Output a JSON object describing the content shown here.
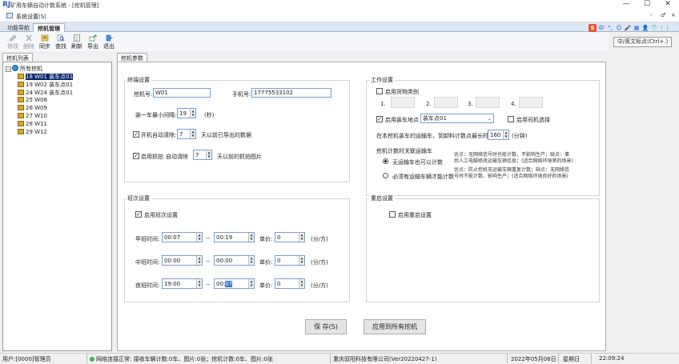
{
  "app": {
    "title": "矿用车辆自动计数系统 - [挖机管理]",
    "logo": "RJ",
    "menu_item": "系统设置(S)",
    "minimize": "—",
    "maximize": "☐",
    "close": "✕",
    "mdi_controls": [
      "-",
      "♂",
      "×"
    ]
  },
  "tabs": [
    {
      "label": "功能导航"
    },
    {
      "label": "挖机管理"
    }
  ],
  "toolbar": {
    "buttons": [
      {
        "label": "修改",
        "icon": "edit-icon",
        "disabled": true
      },
      {
        "label": "删除",
        "icon": "delete-icon",
        "disabled": true
      },
      {
        "label": "同步",
        "icon": "sync-icon",
        "disabled": false
      },
      {
        "label": "查找",
        "icon": "search-icon",
        "disabled": false
      },
      {
        "label": "刷新",
        "icon": "refresh-icon",
        "disabled": false
      },
      {
        "label": "导出",
        "icon": "export-icon",
        "disabled": false
      },
      {
        "label": "退出",
        "icon": "exit-icon",
        "disabled": false
      }
    ]
  },
  "ime": {
    "items": [
      "S",
      "中",
      "°,",
      "☺",
      "🎤",
      "▦",
      "👤",
      "👕",
      "⋮⋮"
    ]
  },
  "lang_button": "中/英文标点(Ctrl+.)",
  "left_panel": {
    "header": "挖机列表",
    "root": "所有挖机",
    "items": [
      "18 W01 装车点01",
      "19 W02 装车点01",
      "24 W24 装车点01",
      "25 W08",
      "26 W09",
      "27 W10",
      "28 W11",
      "29 W12"
    ],
    "selected_index": 0
  },
  "main_panel": {
    "header": "挖机参数",
    "terminal": {
      "title": "终端设置",
      "machine_no_label": "挖机号:",
      "machine_no": "W01",
      "phone_label": "手机号:",
      "phone": "17775533102",
      "interval_label": "装一车最小间隔:",
      "interval": "19",
      "interval_unit": "(秒)",
      "boot_clear_label": "开机自动清除:",
      "boot_clear_value": "7",
      "boot_clear_suffix": "天以前已导出的数据",
      "boot_clear_checked": true,
      "capture_label": "启用抓拍",
      "capture_checked": true,
      "auto_clear_label": "自动清除",
      "auto_clear_value": "7",
      "auto_clear_suffix": "天以前的抓拍图片"
    },
    "work": {
      "title": "工作设置",
      "material_label": "启用货物类别",
      "material_checked": false,
      "slots": [
        "1.",
        "2.",
        "3.",
        "4."
      ],
      "loading_point_label": "启用装车地点",
      "loading_point_checked": true,
      "loading_point_value": "装车点01",
      "driver_label": "启用司机选择",
      "driver_checked": false,
      "count_time_label": "在本挖机装车的运输车，到卸料计数点最长时间",
      "count_time_value": "160",
      "count_time_unit": "(分钟)",
      "relation_title": "挖机计数时关联运输车",
      "option1": "无运输车也可以计数",
      "option1_selected": true,
      "option1_note_1": "优点：无网络信号时也能计数，不影响生产；缺点：事",
      "option1_note_2": "后人工电脑修改运输车辆信息；(适合网络环境差的场景)",
      "option2": "必须有运输车辆才能计数",
      "option2_selected": false,
      "option2_note_1": "优点：防止挖机无运输车辆重复计数；缺点：无网络信",
      "option2_note_2": "号时不能计数，影响生产；(适合网络环境良好的场景)"
    },
    "shift": {
      "title": "班次设置",
      "enable_label": "启用班次设置",
      "enable_checked": true,
      "sep": "--",
      "unit_price_label": "单价:",
      "unit": "(分/方)",
      "rows": [
        {
          "label": "早班时间:",
          "start": "00:07",
          "end": "00:19",
          "price": "0"
        },
        {
          "label": "中班时间:",
          "start": "00:00",
          "end": "00:00",
          "price": "0"
        },
        {
          "label": "夜班时间:",
          "start": "19:00",
          "end_prefix": "00:",
          "end_sel": "07",
          "price": "0"
        }
      ]
    },
    "restart": {
      "title": "重启设置",
      "enable_label": "启用重启设置",
      "enable_checked": false
    },
    "save_button": "保  存(S)",
    "apply_button": "应用到所有挖机"
  },
  "status": {
    "user": "用户:[0000]管理员",
    "network": "网络连接正常: 接收车辆计数:0车、图片:0张；挖机计数:0车、图片:0张",
    "company": "重庆驭阳科技有限公司(Ver20220427-1)",
    "date": "2022年05月08日",
    "weekday": "星期日",
    "time": "22:09:24"
  }
}
